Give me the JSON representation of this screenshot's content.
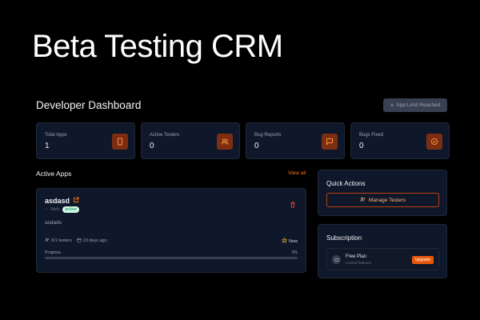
{
  "hero": {
    "title": "Beta Testing CRM"
  },
  "dashboard": {
    "title": "Developer Dashboard",
    "limit_button": "App Limit Reached"
  },
  "stats": [
    {
      "label": "Total Apps",
      "value": "1",
      "icon": "phone-icon"
    },
    {
      "label": "Active Testers",
      "value": "0",
      "icon": "users-icon"
    },
    {
      "label": "Bug Reports",
      "value": "0",
      "icon": "message-icon"
    },
    {
      "label": "Bugs Fixed",
      "value": "0",
      "icon": "check-circle-icon"
    }
  ],
  "active_apps": {
    "title": "Active Apps",
    "view_all": "View all",
    "apps": [
      {
        "name": "asdasd",
        "platform": "Web",
        "status": "active",
        "description": "asdads",
        "testers": "0/1 testers",
        "age": "13 days ago",
        "tag": "New",
        "progress_label": "Progress",
        "progress_percent": "0%",
        "progress": 0
      }
    ]
  },
  "quick_actions": {
    "title": "Quick Actions",
    "manage_testers": "Manage Testers"
  },
  "subscription": {
    "title": "Subscription",
    "plan_name": "Free Plan",
    "plan_desc": "Limited features",
    "upgrade": "Upgrade"
  },
  "colors": {
    "accent": "#f97316",
    "icon_bg": "#7c2d12",
    "card_bg": "#0f172a",
    "badge_bg": "#d1fae5"
  }
}
